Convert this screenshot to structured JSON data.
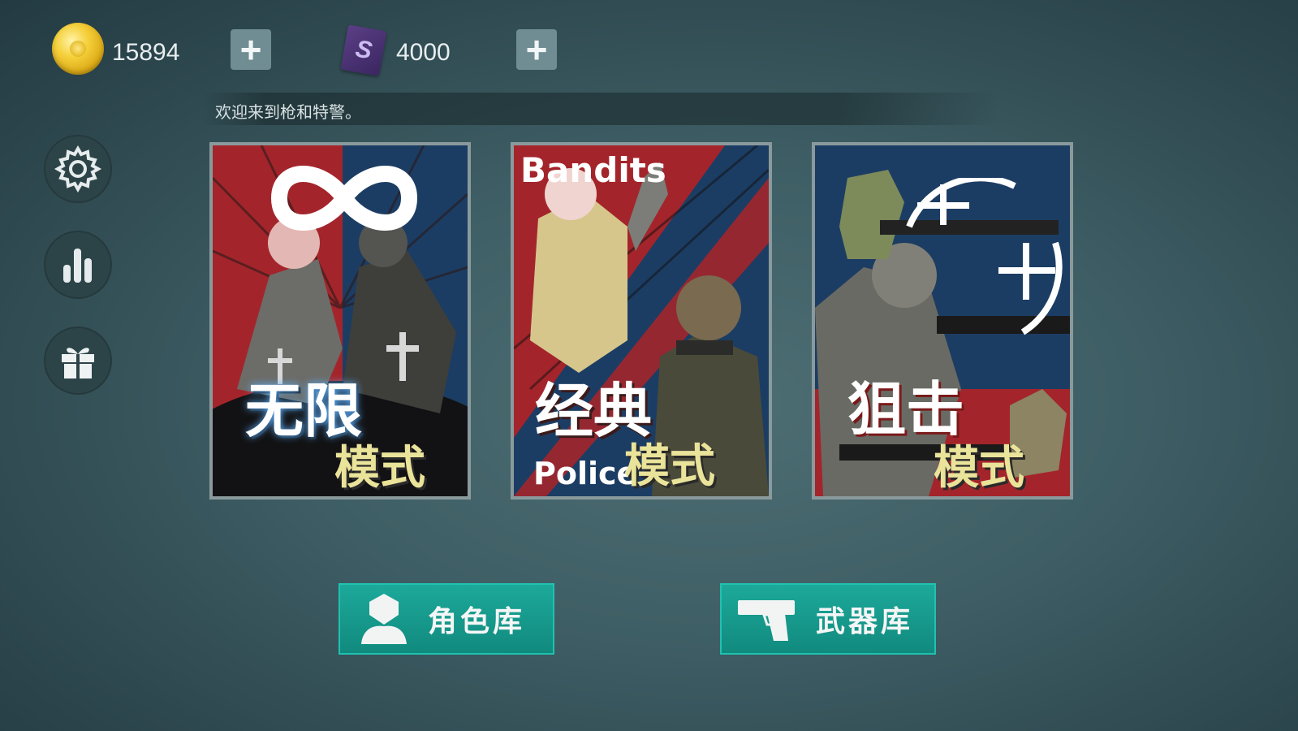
{
  "currency": {
    "coins": {
      "icon": "gold-coin-icon",
      "value": "15894",
      "add_label": "+"
    },
    "gems": {
      "icon": "purple-card-icon",
      "glyph": "S",
      "value": "4000",
      "add_label": "+"
    }
  },
  "welcome_message": "欢迎来到枪和特警。",
  "side_menu": [
    {
      "name": "settings",
      "icon": "gear-icon"
    },
    {
      "name": "stats",
      "icon": "bar-chart-icon"
    },
    {
      "name": "gift",
      "icon": "gift-icon"
    }
  ],
  "modes": [
    {
      "title_line1": "无限",
      "title_line2": "模式",
      "icon": "infinity-icon"
    },
    {
      "title_line1": "经典",
      "title_line2": "模式",
      "top_text": "Bandits",
      "bottom_text": "Police"
    },
    {
      "title_line1": "狙击",
      "title_line2": "模式",
      "icon": "crosshair-icon"
    }
  ],
  "bottom_buttons": {
    "characters": {
      "label": "角色库",
      "icon": "person-icon"
    },
    "weapons": {
      "label": "武器库",
      "icon": "pistol-icon"
    }
  },
  "colors": {
    "teal_button": "#1ca99a",
    "plus_button": "#6f8d92",
    "red": "#a3252b",
    "navy": "#1c3d63",
    "title_yellow": "#eae39a"
  }
}
